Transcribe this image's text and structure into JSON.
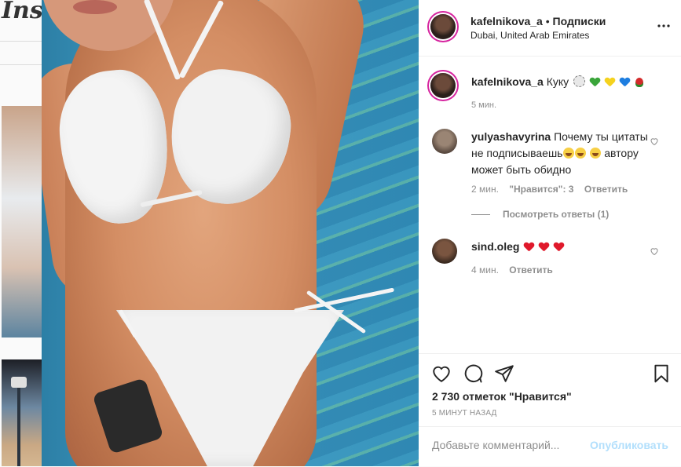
{
  "background": {
    "logo_text": "Insta"
  },
  "post": {
    "username": "kafelnikova_a",
    "separator": "•",
    "follow_label": "Подписки",
    "location": "Dubai, United Arab Emirates",
    "caption": {
      "username": "kafelnikova_a",
      "text": "Куку",
      "emoji_icons": [
        "sun-icon",
        "green-heart-icon",
        "yellow-heart-icon",
        "blue-heart-icon",
        "rose-icon"
      ],
      "time": "5 мин."
    },
    "comments": [
      {
        "username": "yulyashavyrina",
        "text_line1": "Почему ты",
        "text_line2": "цитаты не подписываешь",
        "text_line3": "автору может быть обидно",
        "time": "2 мин.",
        "likes_label": "\"Нравится\": 3",
        "reply_label": "Ответить",
        "view_replies": "Посмотреть ответы (1)"
      },
      {
        "username": "sind.oleg",
        "time": "4 мин.",
        "reply_label": "Ответить"
      }
    ],
    "likes": "2 730 отметок \"Нравится\"",
    "time_ago": "5 МИНУТ НАЗАД",
    "comment_placeholder": "Добавьте комментарий...",
    "post_button": "Опубликовать"
  },
  "colors": {
    "accent_blue": "#b2dffc",
    "secondary_text": "#8e8e8e",
    "heart_red": "#e0192b",
    "heart_green": "#3aa53a",
    "heart_yellow": "#f5d21e",
    "heart_blue": "#1e7ee0"
  }
}
